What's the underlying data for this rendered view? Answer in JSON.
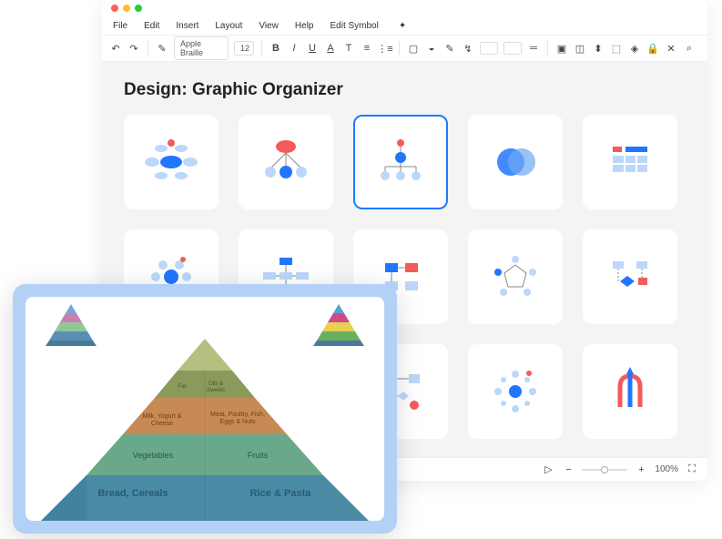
{
  "menus": [
    "File",
    "Edit",
    "Insert",
    "Layout",
    "View",
    "Help",
    "Edit Symbol"
  ],
  "toolbar": {
    "font": "Apple Braille",
    "size": "12"
  },
  "heading": "Design: Graphic Organizer",
  "templates": [
    "cluster-map",
    "hierarchy-tree",
    "org-chart",
    "venn-diagram",
    "table-chart",
    "bubble-cluster",
    "process-map",
    "flowchart",
    "spider-web",
    "decision-flow",
    "funnel",
    "timeline",
    "sequence-flow",
    "radial-burst",
    "merge-split"
  ],
  "zoom": {
    "value": "100%"
  },
  "pyramid": {
    "layers": [
      {
        "left": "Bread, Cereals",
        "right": "Rice & Pasta"
      },
      {
        "left": "Vegetables",
        "right": "Fruits"
      },
      {
        "left": "Milk, Yogurt & Cheese",
        "right": "Meat, Poultry, Fish, Eggs & Nuts"
      },
      {
        "left": "Fat",
        "right": "Oils & Sweets"
      }
    ]
  }
}
